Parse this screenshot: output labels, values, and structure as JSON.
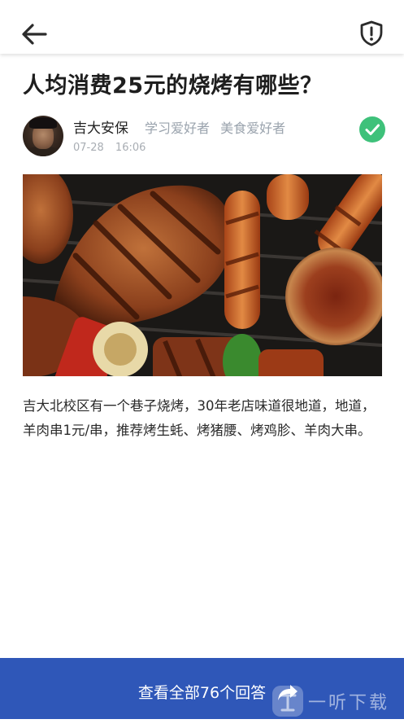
{
  "header": {
    "back_icon": "arrow-left-icon",
    "report_icon": "shield-alert-icon"
  },
  "post": {
    "title": "人均消费25元的烧烤有哪些？",
    "author": {
      "name": "吉大安保",
      "tags": [
        "学习爱好者",
        "美食爱好者"
      ],
      "date": "07-28",
      "time": "16:06",
      "verified_icon": "check-circle-icon",
      "verified_color": "#3ec17a"
    },
    "photo_subject": "grilled-meat-and-sausages",
    "body": "吉大北校区有一个巷子烧烤，30年老店味道很地道，地道，羊肉串1元/串，推荐烤生蚝、烤猪腰、烤鸡胗、羊肉大串。"
  },
  "footer": {
    "view_all_label": "查看全部76个回答",
    "share_icon": "share-arrow-icon",
    "bar_color": "#2f57b8"
  },
  "watermark": {
    "text": "一听下载"
  }
}
